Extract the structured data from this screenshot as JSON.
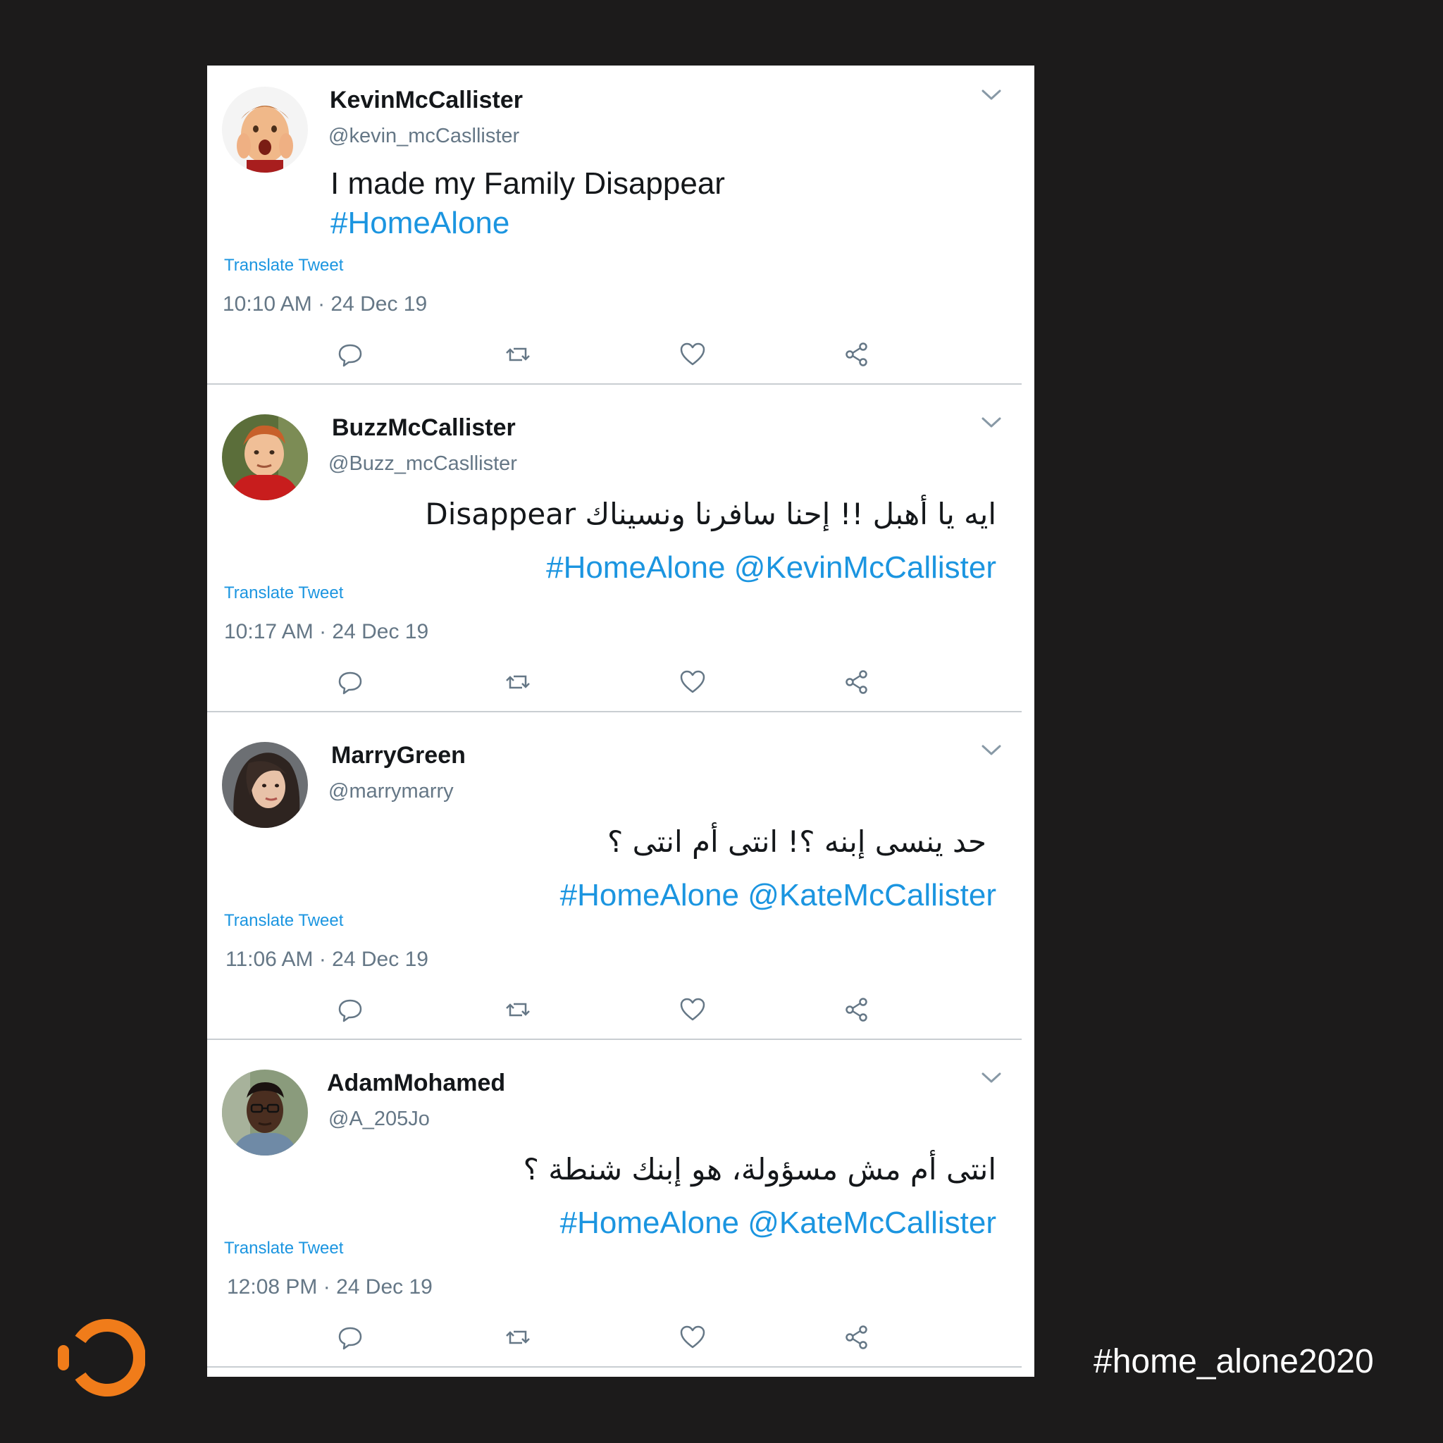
{
  "tweets": [
    {
      "display_name": "KevinMcCallister",
      "handle": "@kevin_mcCasllister",
      "text_lines": [
        "I made my Family Disappear"
      ],
      "links": "#HomeAlone",
      "rtl": false,
      "translate_label": "Translate Tweet",
      "timestamp": "10:10 AM · 24 Dec 19",
      "avatar": "kid-screaming-avatar"
    },
    {
      "display_name": "BuzzMcCallister",
      "handle": "@Buzz_mcCasllister",
      "text_lines": [
        "ايه يا أهبل !! إحنا سافرنا ونسيناك Disappear"
      ],
      "links": "#HomeAlone @KevinMcCallister",
      "rtl": true,
      "translate_label": "Translate Tweet",
      "timestamp": "10:17 AM · 24 Dec 19",
      "avatar": "teen-red-jacket-avatar"
    },
    {
      "display_name": "MarryGreen",
      "handle": "@marrymarry",
      "text_lines": [
        "حد ينسى إبنه ؟! انتى أم انتى ؟"
      ],
      "links": "#HomeAlone @KateMcCallister",
      "rtl": true,
      "translate_label": "Translate Tweet",
      "timestamp": "11:06 AM · 24 Dec 19",
      "avatar": "woman-portrait-avatar"
    },
    {
      "display_name": "AdamMohamed",
      "handle": "@A_205Jo",
      "text_lines": [
        "انتى أم مش مسؤولة، هو إبنك شنطة ؟"
      ],
      "links": "#HomeAlone @KateMcCallister",
      "rtl": true,
      "translate_label": "Translate Tweet",
      "timestamp": "12:08 PM · 24 Dec 19",
      "avatar": "man-glasses-avatar"
    }
  ],
  "actions": [
    "reply-icon",
    "retweet-icon",
    "like-icon",
    "share-icon"
  ],
  "footer": {
    "hashtag": "#home_alone2020",
    "logo": "orange-ring-logo"
  },
  "colors": {
    "background": "#1c1b1b",
    "card": "#ffffff",
    "link": "#1b95e0",
    "text": "#14171a",
    "muted": "#657786",
    "accent": "#f07c1a"
  }
}
